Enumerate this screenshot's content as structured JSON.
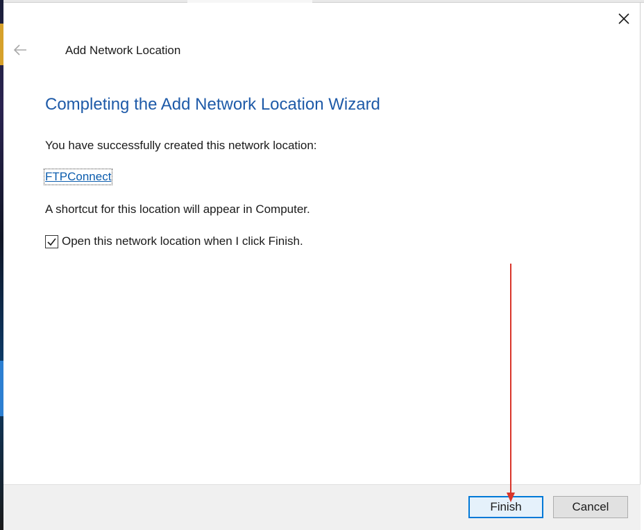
{
  "dialog": {
    "title": "Add Network Location",
    "heading": "Completing the Add Network Location Wizard",
    "message": "You have successfully created this network location:",
    "location_name": "FTPConnect",
    "shortcut_note": "A shortcut for this location will appear in Computer.",
    "open_checkbox": {
      "label": "Open this network location when I click Finish.",
      "checked": true
    }
  },
  "buttons": {
    "finish_label": "Finish",
    "cancel_label": "Cancel"
  },
  "icons": {
    "close": "close-icon",
    "back": "back-arrow-icon",
    "check": "checkmark-icon"
  },
  "colors": {
    "heading": "#1e5aa8",
    "link": "#0b5cad",
    "focus_border": "#0078d7",
    "annotation_arrow": "#d9352a"
  }
}
